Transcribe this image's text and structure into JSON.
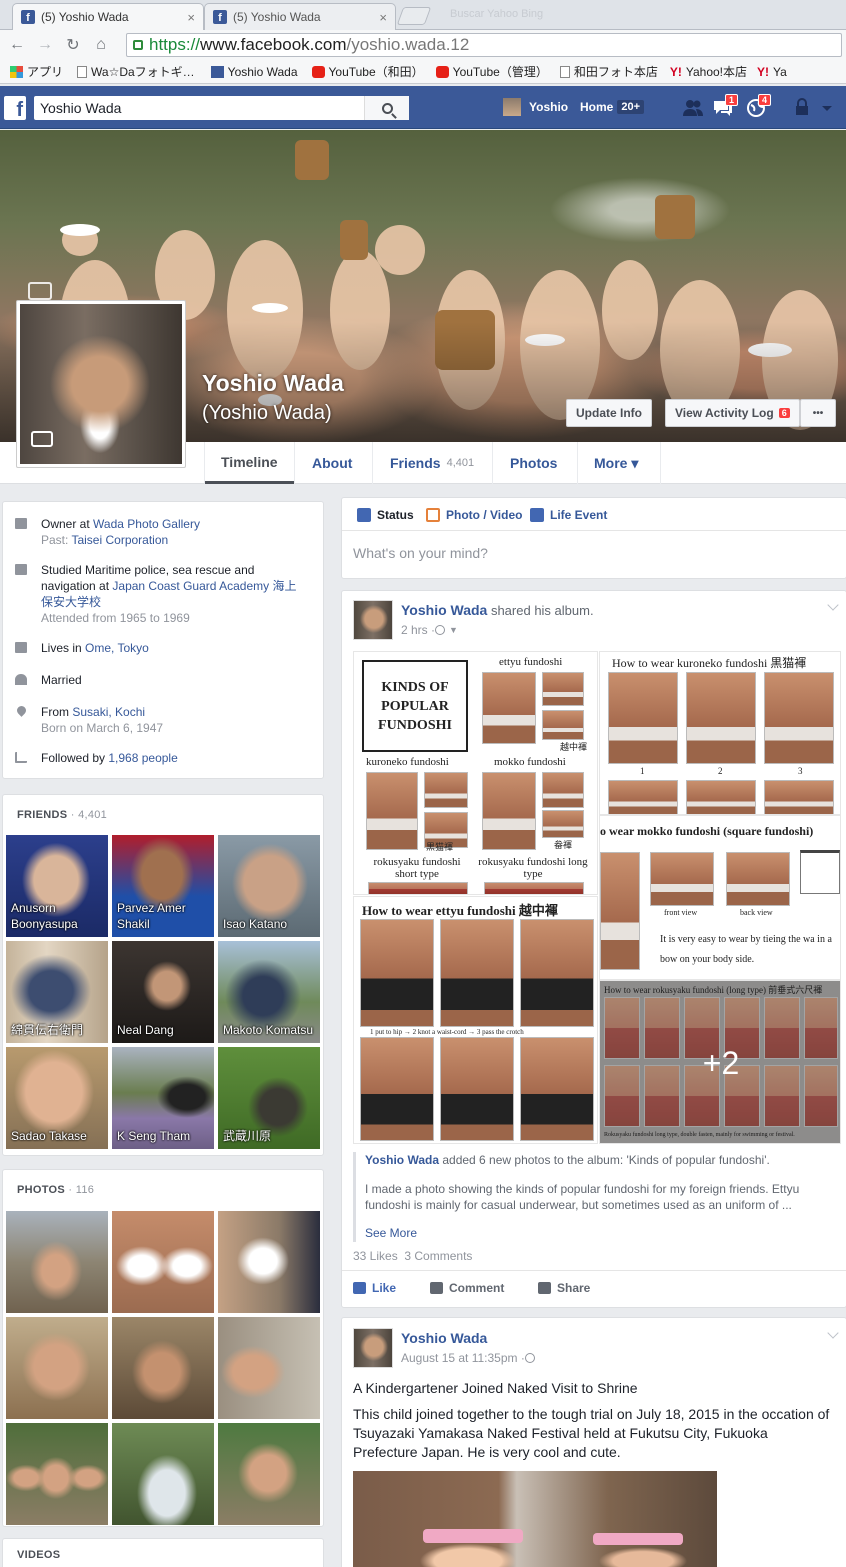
{
  "browser": {
    "tabs": [
      {
        "title": "(5) Yoshio Wada",
        "close": "×"
      },
      {
        "title": "(5) Yoshio Wada",
        "close": "×"
      }
    ],
    "blurred_tab": "Buscar  Yahoo  Bing",
    "url": {
      "scheme": "https://",
      "host": "www.facebook.com",
      "path": "/yoshio.wada.12"
    },
    "bookmarks": [
      {
        "icon": "apps-icon",
        "label": "アプリ"
      },
      {
        "icon": "page-icon",
        "label": "Wa☆Daフォトギ…"
      },
      {
        "icon": "facebook-icon",
        "label": "Yoshio Wada"
      },
      {
        "icon": "youtube-icon",
        "label": "YouTube（和田）"
      },
      {
        "icon": "youtube-icon",
        "label": "YouTube（管理）"
      },
      {
        "icon": "page-icon",
        "label": "和田フォト本店"
      },
      {
        "icon": "yahoo-icon",
        "label": "Yahoo!本店"
      },
      {
        "icon": "yahoo-icon",
        "label": "Ya"
      }
    ]
  },
  "fb_bar": {
    "search_value": "Yoshio  Wada",
    "user_name": "Yoshio",
    "home_label": "Home",
    "home_count": "20+",
    "messages_count": "1",
    "notifications_count": "4"
  },
  "profile": {
    "name": "Yoshio Wada",
    "alternate_name": "(Yoshio Wada)",
    "update_info": "Update Info",
    "activity_log": "View Activity Log",
    "activity_count": "6",
    "more_dots": "•••"
  },
  "timeline_nav": {
    "timeline": "Timeline",
    "about": "About",
    "friends": "Friends",
    "friends_count": "4,401",
    "photos": "Photos",
    "more": "More ▾"
  },
  "intro": {
    "work_prefix": "Owner at ",
    "work_link": "Wada Photo Gallery",
    "past_prefix": "Past: ",
    "past_link": "Taisei Corporation",
    "study_text": "Studied Maritime police, sea rescue and navigation at ",
    "study_link": "Japan Coast Guard Academy 海上保安大学校",
    "study_years": "Attended from 1965 to 1969",
    "lives_prefix": "Lives in ",
    "lives_link": "Ome, Tokyo",
    "relationship": "Married",
    "from_prefix": "From ",
    "from_link": "Susaki, Kochi",
    "born": "Born on March 6, 1947",
    "followed_prefix": "Followed by ",
    "followed_link": "1,968 people"
  },
  "friends_section": {
    "title": "FRIENDS",
    "count": "4,401",
    "friends": [
      {
        "name": "Anusorn Boonyasupa"
      },
      {
        "name": "Parvez Amer Shakil"
      },
      {
        "name": "Isao Katano"
      },
      {
        "name": "綿貫伝右衛門"
      },
      {
        "name": "Neal Dang"
      },
      {
        "name": "Makoto Komatsu"
      },
      {
        "name": "Sadao Takase"
      },
      {
        "name": "K Seng Tham"
      },
      {
        "name": "武蔵川原"
      }
    ]
  },
  "photos_section": {
    "title": "PHOTOS",
    "count": "116"
  },
  "videos_section": {
    "title": "VIDEOS"
  },
  "composer": {
    "status": "Status",
    "photo_video": "Photo / Video",
    "life_event": "Life Event",
    "placeholder": "What's on your mind?"
  },
  "post1": {
    "author": "Yoshio Wada",
    "action": " shared his album.",
    "time": "2 hrs · ",
    "gallery": {
      "kinds_title": "KINDS OF POPULAR FUNDOSHI",
      "ettyu": "ettyu fundoshi",
      "kuroneko": "kuroneko fundoshi",
      "mokko": "mokko fundoshi",
      "rokusyaku_short": "rokusyaku fundoshi short type",
      "rokusyaku_long": "rokusyaku fundoshi long type",
      "kanji_ettyu": "越中褌",
      "kanji_kuroneko": "黒猫褌",
      "kanji_mokko": "畚褌",
      "wear_kuroneko": "How to wear kuroneko fundoshi 黒猫褌",
      "wear_mokko": "o wear mokko fundoshi  (square fundoshi)",
      "mokko_front": "front view",
      "mokko_back": "back view",
      "mokko_text": "It is very easy to wear by tieing the wa in a bow on your body side.",
      "wear_ettyu": "How to wear ettyu fundoshi 越中褌",
      "ettyu_steps": "1 put to hip  →   2 knot a waist-cord  →   3 pass the crotch",
      "wear_rokusyaku": "How to wear rokusyaku fundoshi (long type) 前垂式六尺褌",
      "rokusyaku_caption": "Rokusyaku fundoshi long type, double fasten, mainly for swimming or festival.",
      "more_count": "+2"
    },
    "album_author": "Yoshio Wada",
    "album_text": " added 6 new photos to the album: 'Kinds of popular fundoshi'.",
    "body": "I made a photo showing the kinds of popular fundoshi for my foreign friends. Ettyu fundoshi is mainly for casual underwear, but sometimes used as an uniform of ...",
    "see_more": "See More",
    "likes": "33 Likes",
    "comments": "3 Comments",
    "like": "Like",
    "comment": "Comment",
    "share": "Share"
  },
  "post2": {
    "author": "Yoshio Wada",
    "time": "August 15 at 11:35pm · ",
    "title": "A Kindergartener Joined Naked Visit to Shrine",
    "body": "This child joined together to the tough trial on July 18, 2015 in the occation of Tsuyazaki Yamakasa Naked Festival held at Fukutsu City, Fukuoka Prefecture Japan. He is very cool and cute."
  },
  "colors": {
    "fb_blue": "#3b5998",
    "link": "#365899",
    "badge_red": "#fa3e3e"
  }
}
